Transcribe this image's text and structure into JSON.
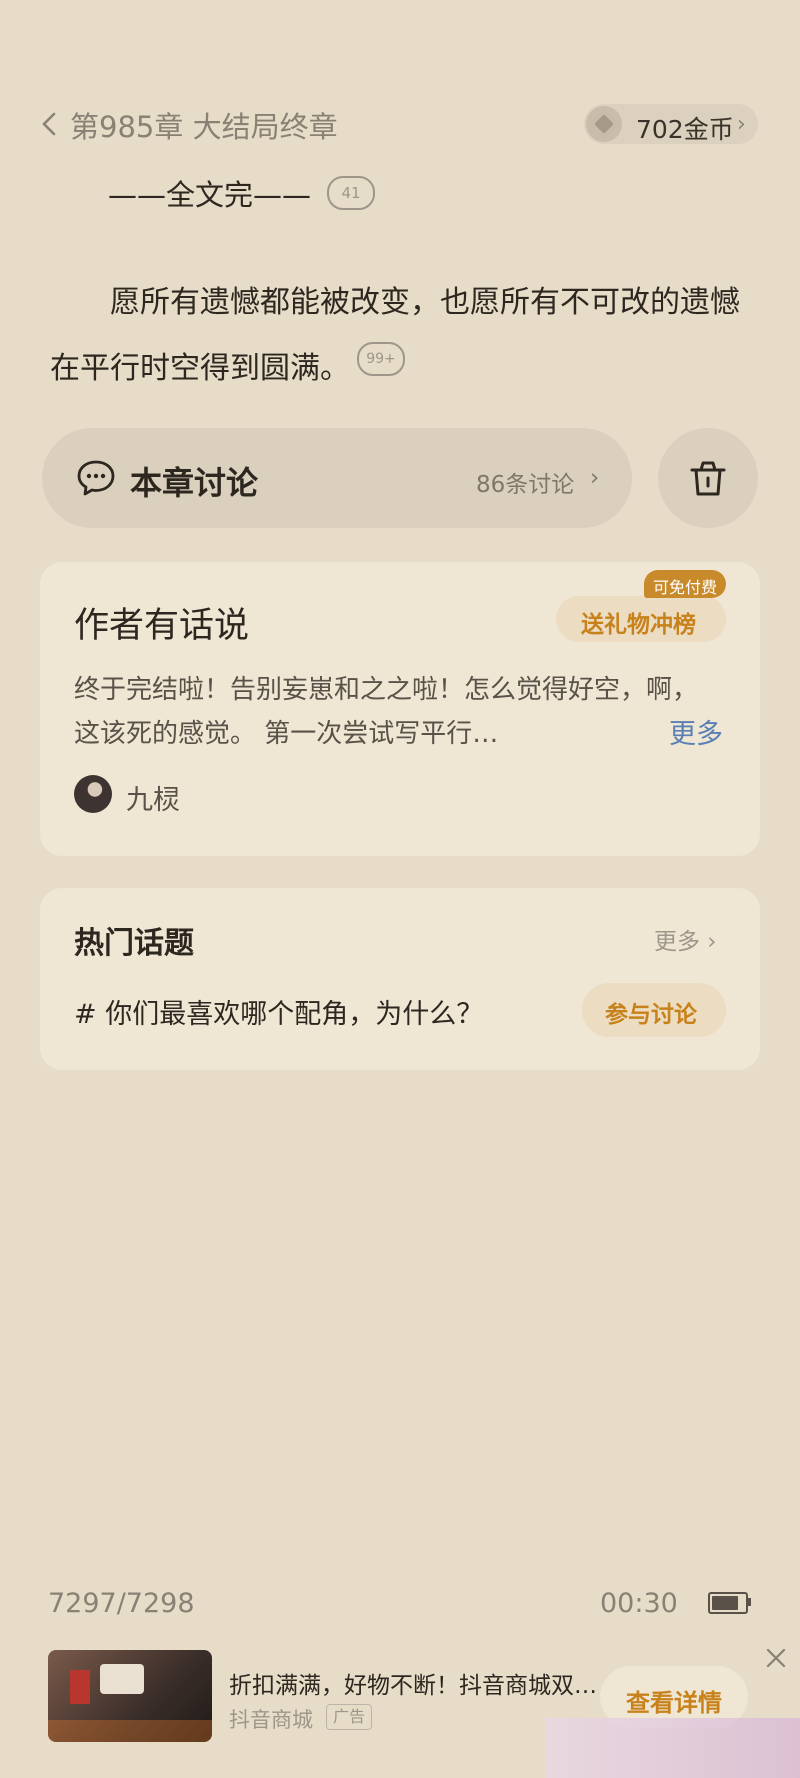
{
  "header": {
    "back_icon": "chevron-left-icon",
    "chapter_title": "第985章 大结局终章",
    "coins_label": "702金币",
    "coins_icon": "coin-icon",
    "coins_chevron": "›"
  },
  "content": {
    "end_line": "——全文完——",
    "end_comment_count": "41",
    "paragraph": "愿所有遗憾都能被改变，也愿所有不可改的遗憾在平行时空得到圆满。",
    "paragraph_comment_count": "99+"
  },
  "discussion": {
    "icon": "chat-bubble-icon",
    "title": "本章讨论",
    "count": "86条讨论",
    "chevron": "›",
    "trash_icon": "trash-icon"
  },
  "author_note": {
    "title": "作者有话说",
    "gift_button": "送礼物冲榜",
    "free_badge": "可免付费",
    "body": "终于完结啦！告别妄崽和之之啦！怎么觉得好空，啊，这该死的感觉。 第一次尝试写平行…",
    "more": "更多",
    "author_name": "九棂"
  },
  "hot_topics": {
    "title": "热门话题",
    "more": "更多 ›",
    "topic": "# 你们最喜欢哪个配角，为什么？",
    "join_button": "参与讨论"
  },
  "footer": {
    "progress": "7297/7298",
    "time": "00:30"
  },
  "ad": {
    "title": "折扣满满，好物不断！抖音商城双…",
    "brand": "抖音商城",
    "tag": "广告",
    "button": "查看详情",
    "close_icon": "close-icon"
  },
  "colors": {
    "background": "#e6dcc8",
    "card": "#efe6d4",
    "accent": "#c8821c",
    "link": "#5a7fb5"
  }
}
